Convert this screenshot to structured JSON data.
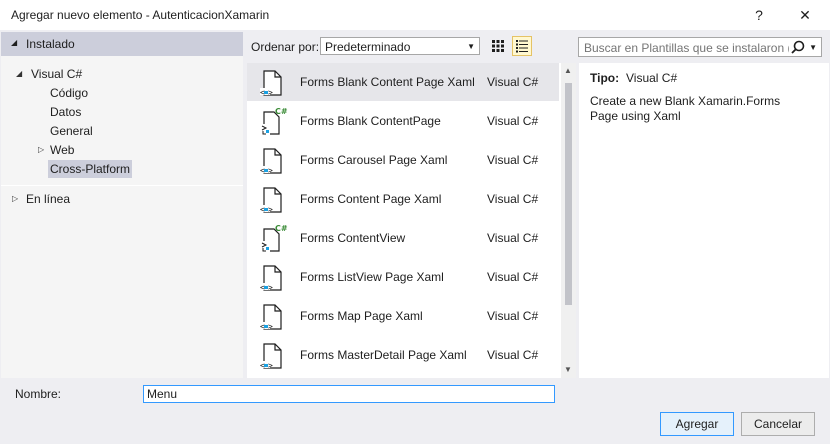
{
  "window": {
    "title": "Agregar nuevo elemento - AutenticacionXamarin",
    "help_label": "?",
    "close_label": "✕"
  },
  "left": {
    "header_label": "Instalado",
    "tree": [
      {
        "label": "Visual C#",
        "level": 0,
        "expander": "◢"
      },
      {
        "label": "Código",
        "level": 1
      },
      {
        "label": "Datos",
        "level": 1
      },
      {
        "label": "General",
        "level": 1
      },
      {
        "label": "Web",
        "level": 1,
        "expander": "▷"
      },
      {
        "label": "Cross-Platform",
        "level": 1,
        "selected": true
      }
    ],
    "online_label": "En línea",
    "online_expander": "▷"
  },
  "toolbar": {
    "sort_label": "Ordenar por:",
    "sort_value": "Predeterminado"
  },
  "search": {
    "placeholder": "Buscar en Plantillas que se instalaron (C"
  },
  "templates": [
    {
      "name": "Forms Blank Content Page Xaml",
      "lang": "Visual C#",
      "icon": "xaml-page-icon",
      "selected": true
    },
    {
      "name": "Forms Blank ContentPage",
      "lang": "Visual C#",
      "icon": "csharp-page-icon"
    },
    {
      "name": "Forms Carousel Page Xaml",
      "lang": "Visual C#",
      "icon": "xaml-page-icon"
    },
    {
      "name": "Forms Content Page Xaml",
      "lang": "Visual C#",
      "icon": "xaml-page-icon"
    },
    {
      "name": "Forms ContentView",
      "lang": "Visual C#",
      "icon": "csharp-page-icon"
    },
    {
      "name": "Forms ListView Page Xaml",
      "lang": "Visual C#",
      "icon": "xaml-page-icon"
    },
    {
      "name": "Forms Map Page Xaml",
      "lang": "Visual C#",
      "icon": "xaml-page-icon"
    },
    {
      "name": "Forms MasterDetail Page Xaml",
      "lang": "Visual C#",
      "icon": "xaml-page-icon"
    }
  ],
  "details": {
    "type_label": "Tipo:",
    "type_value": "Visual C#",
    "description": "Create a new Blank Xamarin.Forms Page using Xaml"
  },
  "footer": {
    "name_label": "Nombre:",
    "name_value": "Menu",
    "add_label": "Agregar",
    "cancel_label": "Cancelar"
  },
  "colors": {
    "accent": "#3399ff",
    "selection": "#cccedb",
    "csharp_green": "#388a34"
  }
}
